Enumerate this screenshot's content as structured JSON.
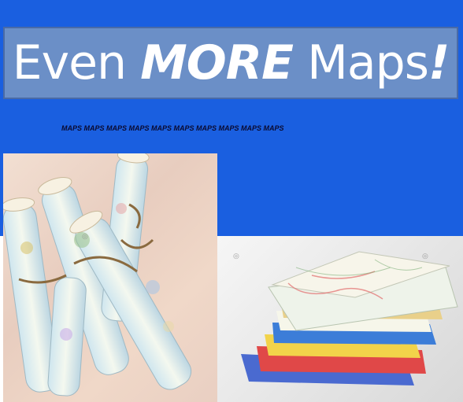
{
  "header": {
    "title_prefix": "Even ",
    "title_emphasis": "MORE",
    "title_suffix": " Maps",
    "title_punct": "!",
    "tagline": "MAPS MAPS MAPS MAPS MAPS MAPS MAPS MAPS MAPS MAPS"
  },
  "colors": {
    "banner": "#1a5fe0",
    "title_box": "#6b8fc7",
    "title_text": "#ffffff"
  },
  "images": {
    "left": "rolled-maps-photo",
    "right": "folded-maps-stack-photo"
  }
}
